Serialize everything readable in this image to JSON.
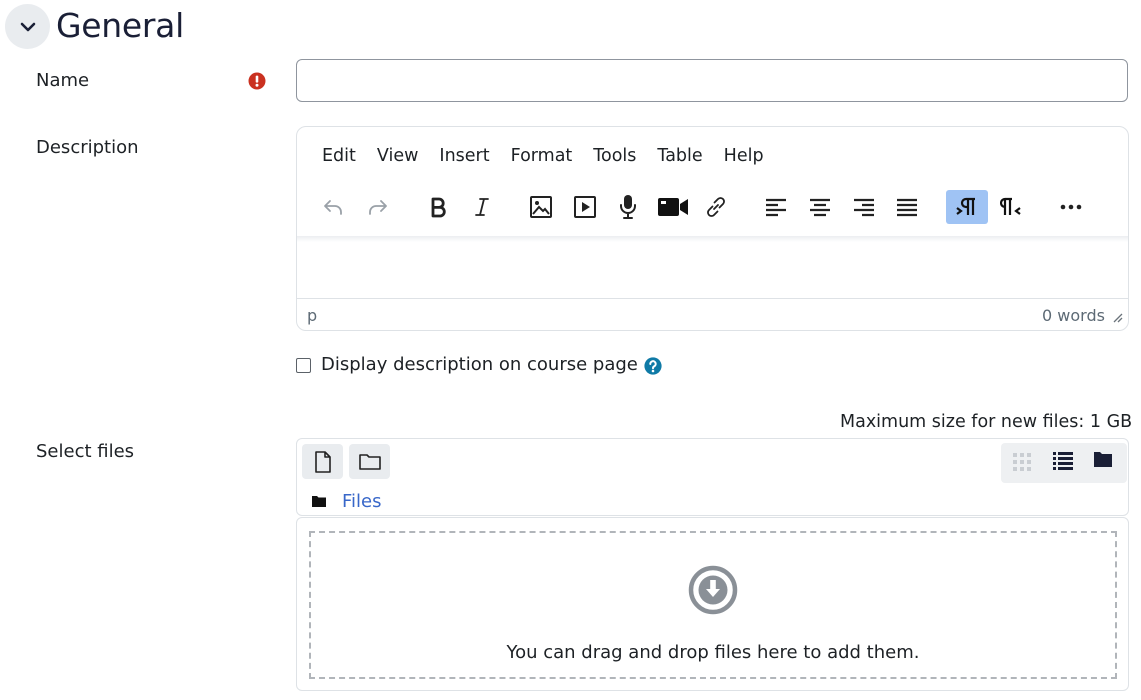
{
  "section": {
    "title": "General",
    "toggle_icon": "chevron-down-icon"
  },
  "name_field": {
    "label": "Name",
    "value": "",
    "required_icon": "exclamation-circle-icon",
    "required_color": "#ca3120"
  },
  "description": {
    "label": "Description",
    "menu": [
      "Edit",
      "View",
      "Insert",
      "Format",
      "Tools",
      "Table",
      "Help"
    ],
    "toolbar": [
      "undo-icon",
      "redo-icon",
      "bold-icon",
      "italic-icon",
      "image-icon",
      "media-icon",
      "microphone-icon",
      "video-camera-icon",
      "link-icon",
      "align-left-icon",
      "align-center-icon",
      "align-right-icon",
      "justify-icon",
      "ltr-icon",
      "rtl-icon",
      "more-icon"
    ],
    "active_tool_color": "#9fc3f4",
    "status_path": "p",
    "word_count": "0 words"
  },
  "display_description": {
    "label": "Display description on course page",
    "checked": false,
    "help_icon": "question-circle-icon",
    "help_color": "#0f6cbf"
  },
  "files": {
    "label": "Select files",
    "max_size": "Maximum size for new files: 1 GB",
    "breadcrumb": "Files",
    "link_color": "#3867c9",
    "drop_text": "You can drag and drop files here to add them."
  }
}
